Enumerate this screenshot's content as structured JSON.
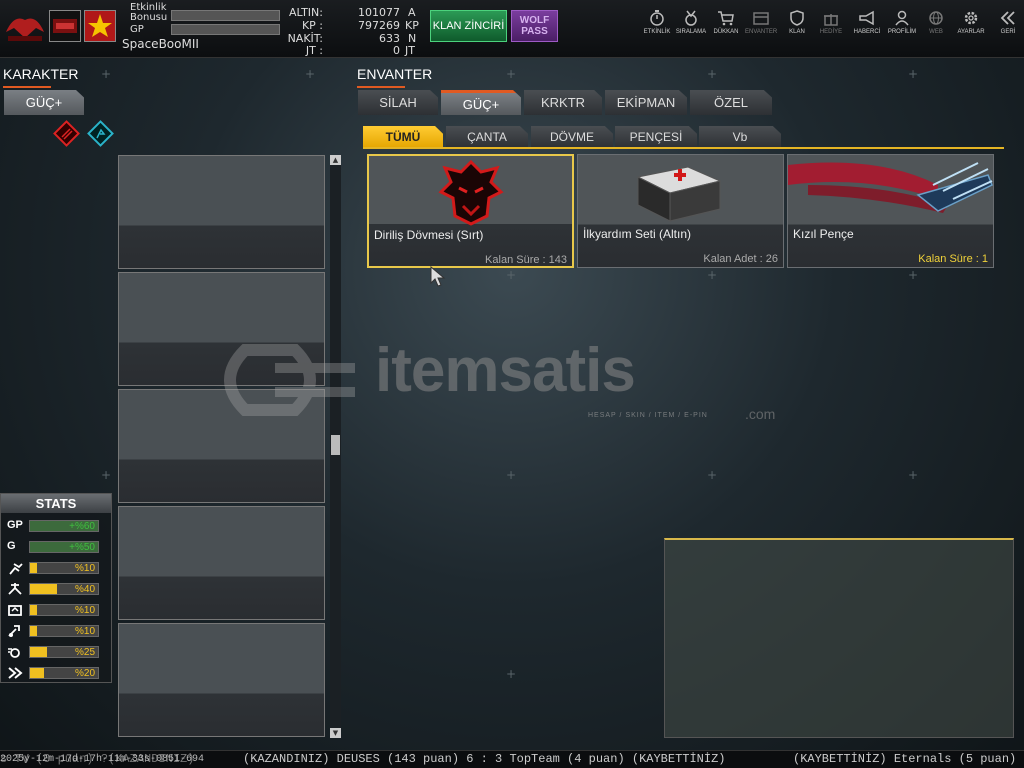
{
  "topbar": {
    "event_bonus_label": "Etkinlik\nBonusu",
    "gp_label": "GP",
    "username": "SpaceBooMII",
    "currencies": [
      {
        "label": "ALTIN:",
        "value": "101077",
        "unit": "A"
      },
      {
        "label": "KP :",
        "value": "797269",
        "unit": "KP"
      },
      {
        "label": "NAKİT:",
        "value": "633",
        "unit": "N"
      },
      {
        "label": "JT :",
        "value": "0",
        "unit": "JT"
      }
    ],
    "klan_button": "KLAN ZİNCİRİ",
    "wolf_button": "WOLF\nPASS",
    "nav": [
      {
        "label": "ETKİNLİK",
        "icon": "stopwatch-icon"
      },
      {
        "label": "SIRALAMA",
        "icon": "medal-icon"
      },
      {
        "label": "DÜKKAN",
        "icon": "cart-icon"
      },
      {
        "label": "ENVANTER",
        "icon": "inventory-icon"
      },
      {
        "label": "KLAN",
        "icon": "shield-icon"
      },
      {
        "label": "HEDİYE",
        "icon": "gift-icon"
      },
      {
        "label": "HABERCİ",
        "icon": "megaphone-icon"
      },
      {
        "label": "PROFİLİM",
        "icon": "profile-icon"
      },
      {
        "label": "WEB",
        "icon": "globe-icon"
      },
      {
        "label": "AYARLAR",
        "icon": "gear-icon"
      },
      {
        "label": "GERİ",
        "icon": "back-icon"
      }
    ]
  },
  "character": {
    "heading": "KARAKTER",
    "tab": "GÜÇ+"
  },
  "inventory": {
    "heading": "ENVANTER",
    "tabs": [
      "SİLAH",
      "GÜÇ+",
      "KRKTR",
      "EKİPMAN",
      "ÖZEL"
    ],
    "active_tab": "GÜÇ+",
    "subtabs": [
      "TÜMÜ",
      "ÇANTA",
      "DÖVME",
      "PENÇESİ",
      "Vb"
    ],
    "active_subtab": "TÜMÜ",
    "items": [
      {
        "name": "Diriliş Dövmesi (Sırt)",
        "remaining": "Kalan Süre : 143"
      },
      {
        "name": "İlkyardım Seti (Altın)",
        "remaining": "Kalan Adet : 26"
      },
      {
        "name": "Kızıl Pençe",
        "remaining": "Kalan Süre : 1"
      }
    ]
  },
  "stats": {
    "title": "STATS",
    "rows": [
      {
        "icon": "GP",
        "value": "+%60",
        "fill": 1.0,
        "color": "#3fbf3f"
      },
      {
        "icon": "G",
        "value": "+%50",
        "fill": 1.0,
        "color": "#3fbf3f"
      },
      {
        "icon": "run-icon",
        "value": "%10",
        "fill": 0.1,
        "color": "#f0c020"
      },
      {
        "icon": "power-icon",
        "value": "%40",
        "fill": 0.4,
        "color": "#f0c020"
      },
      {
        "icon": "defense-icon",
        "value": "%10",
        "fill": 0.1,
        "color": "#f0c020"
      },
      {
        "icon": "health-icon",
        "value": "%10",
        "fill": 0.1,
        "color": "#f0c020"
      },
      {
        "icon": "speed-icon",
        "value": "%25",
        "fill": 0.25,
        "color": "#f0c020"
      },
      {
        "icon": "dash-icon",
        "value": "%20",
        "fill": 0.2,
        "color": "#f0c020"
      }
    ]
  },
  "ticker": {
    "left": "2025y-12m-17d-17h-11m-33s-0851-694",
    "left_behind": "s TV (0 puan) ?(KAZANDINIZ)",
    "middle": "(KAZANDINIZ) DEUSES (143 puan) 6 : 3 TopTeam (4 puan) (KAYBETTİNİZ)",
    "right": "(KAYBETTİNİZ) Eternals (5 puan) 9"
  },
  "watermark": {
    "brand": "itemsatis",
    "com": ".com",
    "sub": "HESAP / SKIN / ITEM / E-PIN"
  }
}
